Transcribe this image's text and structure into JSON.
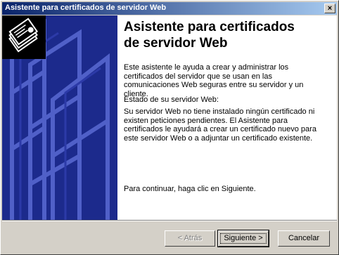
{
  "window": {
    "title": "Asistente para certificados de servidor Web",
    "close_glyph": "×"
  },
  "heading": {
    "line1": "Asistente para certificados",
    "line2": "de servidor Web"
  },
  "body": {
    "intro": "Este asistente le ayuda a crear y administrar los certificados del servidor que se usan en las comunicaciones Web seguras entre su servidor y un cliente.",
    "status_label": "Estado de su servidor Web:",
    "status_text": "Su servidor Web no tiene instalado ningún certificado ni existen peticiones pendientes. El Asistente para certificados le ayudará a crear un certificado nuevo para este servidor Web o a adjuntar un certificado existente.",
    "continue_text": "Para continuar, haga clic en Siguiente."
  },
  "buttons": {
    "back": "< Atrás",
    "next": "Siguiente >",
    "cancel": "Cancelar"
  },
  "icons": {
    "side_logo": "certificate-stack-icon"
  },
  "colors": {
    "side_panel": "#1c2a8c",
    "titlebar_start": "#0a246a",
    "titlebar_end": "#a6caf0"
  }
}
